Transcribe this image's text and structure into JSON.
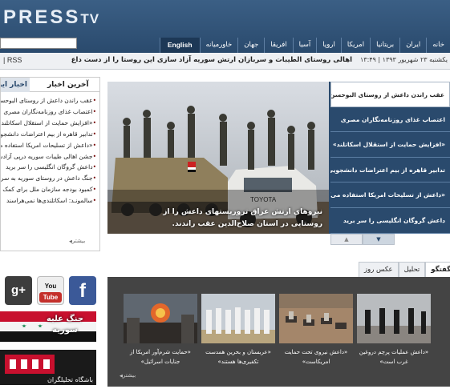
{
  "header": {
    "logo": {
      "part1": "PRESS",
      "part2": "TV"
    },
    "search": {
      "value": "",
      "placeholder": ""
    },
    "nav": [
      "خانه",
      "ایران",
      "بریتانیا",
      "امریکا",
      "اروپا",
      "آسیا",
      "افریقا",
      "جهان",
      "خاورمیانه",
      "English"
    ]
  },
  "ticker": {
    "rss": "RSS",
    "datetime": "یکشنبه ۲۳ شهریور ۱۳۹۳ | ۱۳:۴۹",
    "headline": "اهالی روستای الطیبات و سربازان ارتش سوریه آزاد سازی این روستا را از دست داع"
  },
  "latest_news": {
    "tab_latest": "آخرین اخبار",
    "tab_iran": "اخبار ایران",
    "items": [
      "عقب راندن داعش از روستای البوحسن",
      "اعتصاب غذای روزنامه‌نگاران مصری",
      "«افزایش حمایت از استقلال اسکاتلند»",
      "تدابیر قاهره از بیم اعتراضات دانشجویی",
      "«داعش از تسلیحات امریکا استفاده می‌کند»",
      "جشن اهالی طیبات سوریه درپی آزادسازی",
      "داعش گروگان انگلیسی را سر برید",
      "جنگ داعش در روستای سوریه به سر جویی",
      "کمبود بودجه سازمان ملل برای کمک به",
      "سالمونـد: اسکاتلندی‌ها نمی‌هراسند"
    ],
    "more": "بیشتر"
  },
  "featured": {
    "caption": "نیروهای ارتش عراق تروریستهای داعش را از روستایی در استان صلاح‌الدین عقب راندند.",
    "items": [
      "عقب راندن داعش از روستای البوحسن",
      "اعتصاب غذای روزنامه‌نگاران مصری",
      "«افزایش حمایت از استقلال اسکاتلند»",
      "تدابیر قاهره از بیم اعتراضات دانشجویی",
      "«داعش از تسلیحات امریکا استفاده می‌کند»",
      "داعش گروگان انگلیسی را سر برید"
    ],
    "vehicle_plate": "TOYOTA"
  },
  "social": {
    "gplus": "g+",
    "youtube_top": "You",
    "youtube_bottom": "Tube",
    "facebook": "f"
  },
  "banners": {
    "syria": "جنگ علیه سوریه",
    "khabar": "باشگاه تحلیلگران"
  },
  "multimedia": {
    "tabs": [
      "گفتگو",
      "تحلیل",
      "عکس روز"
    ],
    "cards": [
      "«داعش عملیات پرچم دروغین غرب است»",
      "«داعش نیروی تحت حمایت امریکاست»",
      "«عربستان و بحرین همدست تکفیری‌ها هستند»",
      "«حمایت شرم‌آور امریکا از جنایات اسرائیل»"
    ],
    "more": "بیشتر"
  },
  "colors": {
    "header": "#2a4a6d",
    "nav_active": "#1d3856",
    "panel_dark": "#444444",
    "accent_red": "#7a0e0e"
  }
}
